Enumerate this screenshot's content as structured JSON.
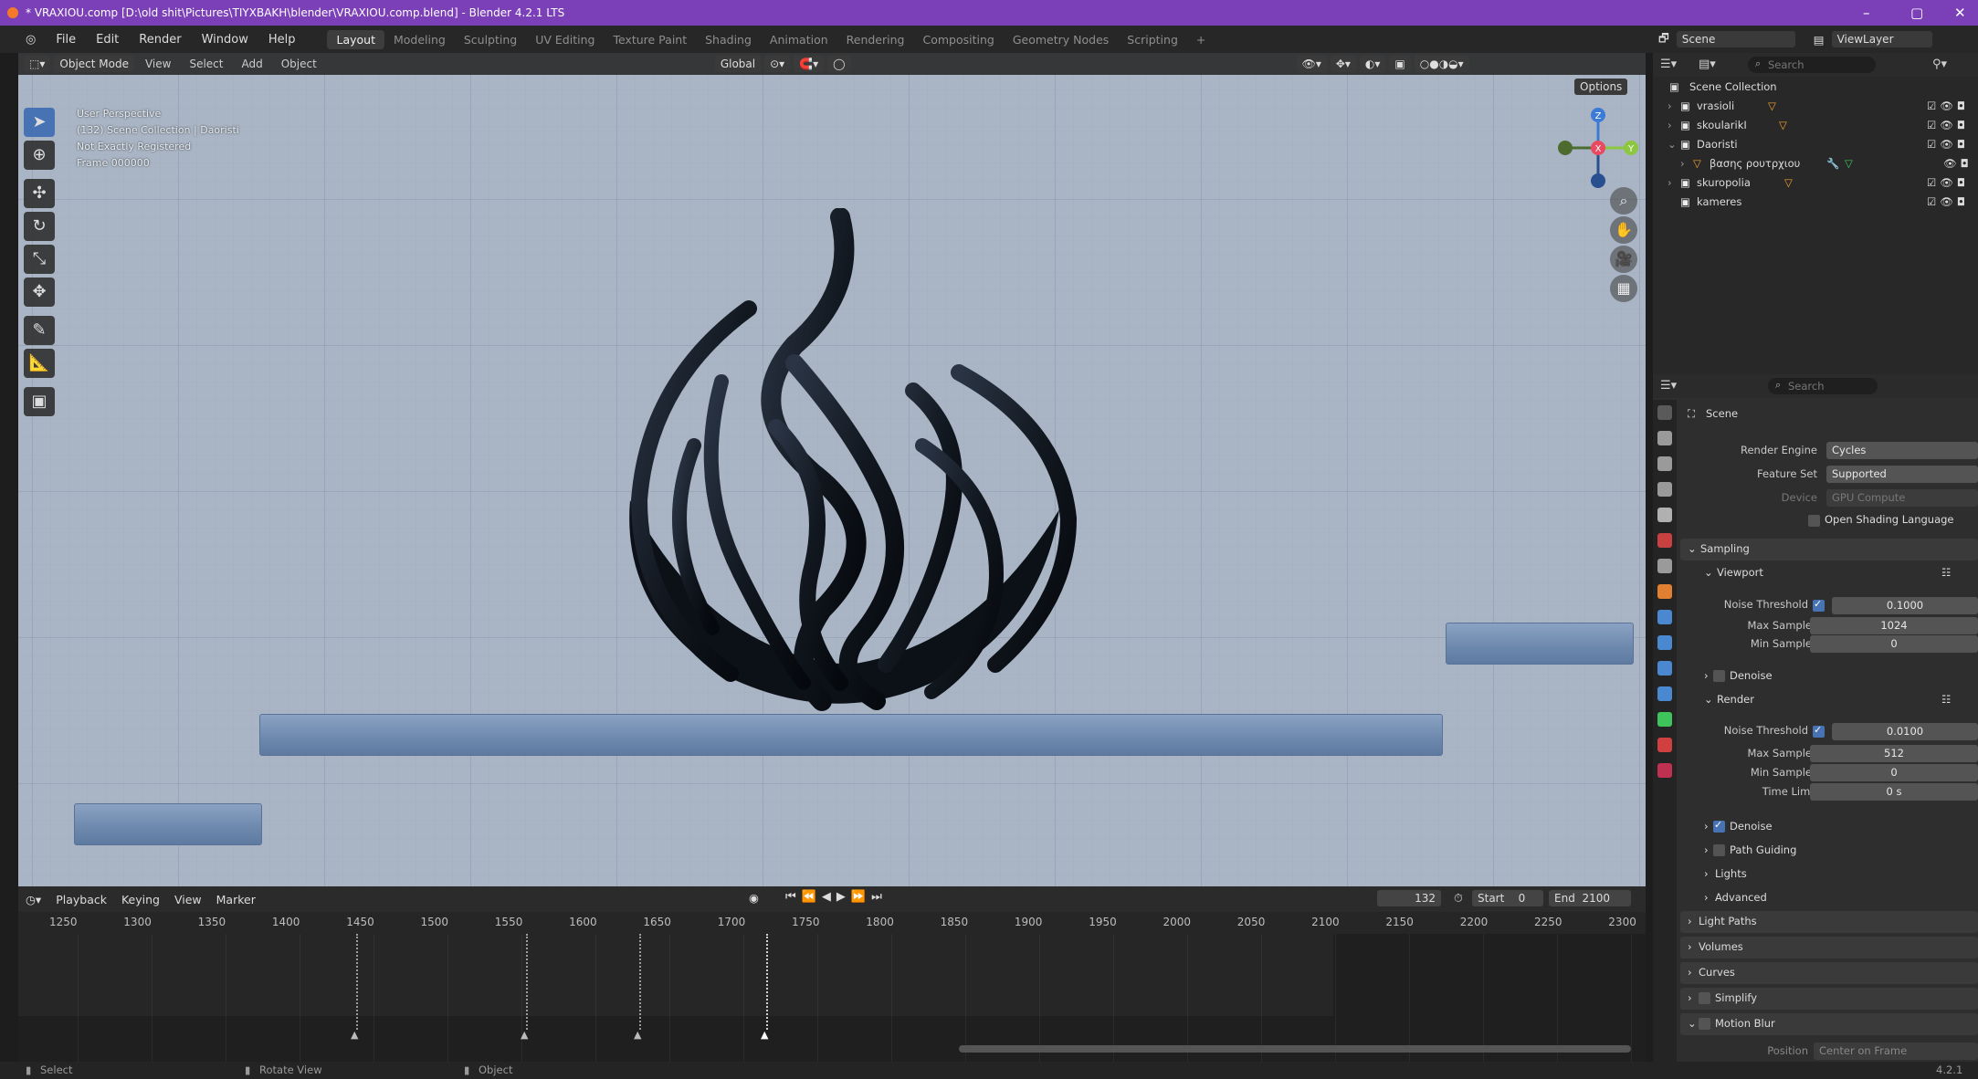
{
  "window": {
    "title": "* VRAXIOU.comp [D:\\old shit\\Pictures\\TIYXBAKH\\blender\\VRAXIOU.comp.blend] - Blender 4.2.1 LTS"
  },
  "menu": [
    "File",
    "Edit",
    "Render",
    "Window",
    "Help"
  ],
  "workspaces": [
    "Layout",
    "Modeling",
    "Sculpting",
    "UV Editing",
    "Texture Paint",
    "Shading",
    "Animation",
    "Rendering",
    "Compositing",
    "Geometry Nodes",
    "Scripting",
    "+"
  ],
  "top_right": {
    "scene": "Scene",
    "view_layer": "ViewLayer"
  },
  "viewport_header": {
    "mode": "Object Mode",
    "menus": [
      "View",
      "Select",
      "Add",
      "Object"
    ],
    "orientation": "Global",
    "options": "Options"
  },
  "viewport_info": [
    "User Perspective",
    "(132) Scene Collection | Daoristi",
    "Not Exactly Registered",
    "Frame 000000"
  ],
  "gizmo": {
    "x": "X",
    "y": "Y",
    "z": "Z"
  },
  "timeline": {
    "menus": [
      "Playback",
      "Keying",
      "View",
      "Marker"
    ],
    "current_frame": "132",
    "start_label": "Start",
    "start": "0",
    "end_label": "End",
    "end": "2100",
    "ruler": [
      "1250",
      "1300",
      "1350",
      "1400",
      "1450",
      "1500",
      "1550",
      "1600",
      "1650",
      "1700",
      "1750",
      "1800",
      "1850",
      "1900",
      "1950",
      "2000",
      "2050",
      "2100",
      "2150",
      "2200",
      "2250",
      "2300"
    ]
  },
  "statusbar": {
    "select": "Select",
    "rotate": "Rotate View",
    "object": "Object",
    "version": "4.2.1"
  },
  "outliner": {
    "search_placeholder": "Search",
    "root": "Scene Collection",
    "items": [
      "vrasioli",
      "skoularikI",
      "Daoristi",
      "βασης ρουτρχιου",
      "skuropolia",
      "kameres"
    ]
  },
  "properties": {
    "search_placeholder": "Search",
    "scene": "Scene",
    "render_engine_label": "Render Engine",
    "render_engine": "Cycles",
    "feature_set_label": "Feature Set",
    "feature_set": "Supported",
    "device_label": "Device",
    "device": "GPU Compute",
    "osl": "Open Shading Language",
    "sampling": "Sampling",
    "viewport": "Viewport",
    "noise_threshold_label": "Noise Threshold",
    "vp_noise": "0.1000",
    "max_samples_label": "Max Samples",
    "vp_max": "1024",
    "min_samples_label": "Min Samples",
    "vp_min": "0",
    "denoise": "Denoise",
    "render": "Render",
    "r_noise": "0.0100",
    "r_max": "512",
    "r_min": "0",
    "time_limit_label": "Time Limit",
    "r_time": "0 s",
    "path_guiding": "Path Guiding",
    "lights": "Lights",
    "advanced": "Advanced",
    "light_paths": "Light Paths",
    "volumes": "Volumes",
    "curves": "Curves",
    "simplify": "Simplify",
    "motion_blur": "Motion Blur",
    "position": "Position",
    "center_on_frame": "Center on Frame"
  }
}
